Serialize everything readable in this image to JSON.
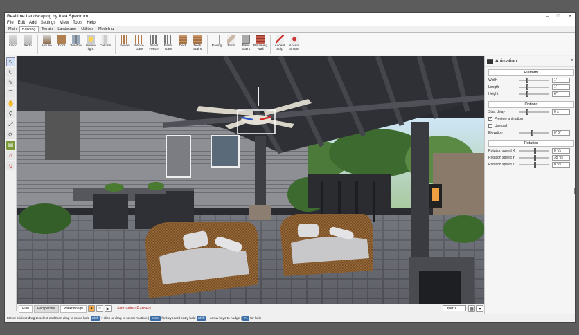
{
  "window": {
    "title": "Realtime Landscaping by Idea Spectrum",
    "controls": [
      "–",
      "□",
      "✕"
    ]
  },
  "menu": [
    "File",
    "Edit",
    "Add",
    "Settings",
    "View",
    "Tools",
    "Help"
  ],
  "tabs": [
    "Main",
    "Building",
    "Terrain",
    "Landscape",
    "Utilities",
    "Modeling"
  ],
  "active_tab": "Building",
  "ribbon": {
    "groups": [
      [
        {
          "label": "Undo",
          "icon": "undo-icon"
        },
        {
          "label": "Redo",
          "icon": "redo-icon"
        }
      ],
      [
        {
          "label": "House",
          "icon": "house-icon"
        },
        {
          "label": "Door",
          "icon": "door-icon"
        },
        {
          "label": "Window",
          "icon": "window-icon"
        },
        {
          "label": "House light",
          "icon": "light-icon"
        },
        {
          "label": "Column",
          "icon": "column-icon"
        }
      ],
      [
        {
          "label": "Fence",
          "icon": "fence-icon"
        },
        {
          "label": "Fence Gate",
          "icon": "fence-gate-icon"
        },
        {
          "label": "Panel Fence",
          "icon": "panel-fence-icon"
        },
        {
          "label": "Panel Gate",
          "icon": "panel-gate-icon"
        },
        {
          "label": "Deck",
          "icon": "deck-icon"
        },
        {
          "label": "Deck Stairs",
          "icon": "deck-stairs-icon"
        }
      ],
      [
        {
          "label": "Railing",
          "icon": "railing-icon"
        },
        {
          "label": "Patio",
          "icon": "patio-icon"
        },
        {
          "label": "Patio Stairs",
          "icon": "patio-stairs-icon"
        },
        {
          "label": "Retaining Wall",
          "icon": "retaining-wall-icon"
        }
      ],
      [
        {
          "label": "Accent Strip",
          "icon": "accent-strip-icon"
        },
        {
          "label": "Accent Shape",
          "icon": "accent-shape-icon"
        }
      ]
    ]
  },
  "left_tools": [
    "select-arrow-icon",
    "rotate-icon",
    "pencil-icon",
    "curve-icon",
    "hand-icon",
    "zoom-icon",
    "zoom-extents-icon",
    "orbit-icon",
    "measure-icon",
    "magnet-icon",
    "snap-icon"
  ],
  "viewport_tabs": [
    "Plan",
    "Perspective",
    "Walkthrough"
  ],
  "active_viewport_tab": "Perspective",
  "playback": {
    "status": "Animation Paused"
  },
  "layer": {
    "value": "Layer 1"
  },
  "panel": {
    "title": "Animation",
    "platform": {
      "heading": "Platform",
      "rows": [
        {
          "label": "Width",
          "value": "1'",
          "pos": 0.25
        },
        {
          "label": "Length",
          "value": "1'",
          "pos": 0.25
        },
        {
          "label": "Height",
          "value": "6\"",
          "pos": 0.25
        }
      ]
    },
    "options": {
      "heading": "Options",
      "start_delay": {
        "label": "Start delay",
        "value": "0 s",
        "pos": 0.25
      },
      "preview": {
        "label": "Preview animation",
        "checked": true
      },
      "use_path": {
        "label": "Use path",
        "checked": false
      },
      "elevation": {
        "label": "Elevation",
        "value": "0' 0\"",
        "pos": 0.4
      }
    },
    "rotation": {
      "heading": "Rotation",
      "rows": [
        {
          "label": "Rotation speed X",
          "value": "0 °/s",
          "pos": 0.5
        },
        {
          "label": "Rotation speed Y",
          "value": "35 °/s",
          "pos": 0.5
        },
        {
          "label": "Rotation speed Z",
          "value": "0 °/s",
          "pos": 0.5
        }
      ]
    }
  },
  "statusbar": {
    "parts": [
      {
        "t": "Move:"
      },
      {
        "t": "click or drag"
      },
      {
        "t": "to select and then drag to move"
      },
      {
        "t": "hold"
      },
      {
        "k": "Shift"
      },
      {
        "t": "+ click or drag"
      },
      {
        "t": "to select multiple"
      },
      {
        "t": "|"
      },
      {
        "k": "Enter"
      },
      {
        "t": "for keyboard entry"
      },
      {
        "t": "hold"
      },
      {
        "k": "Shift"
      },
      {
        "t": "+ Arrow keys to nudge"
      },
      {
        "t": "|"
      },
      {
        "k": "F1"
      },
      {
        "t": "for help"
      }
    ]
  }
}
